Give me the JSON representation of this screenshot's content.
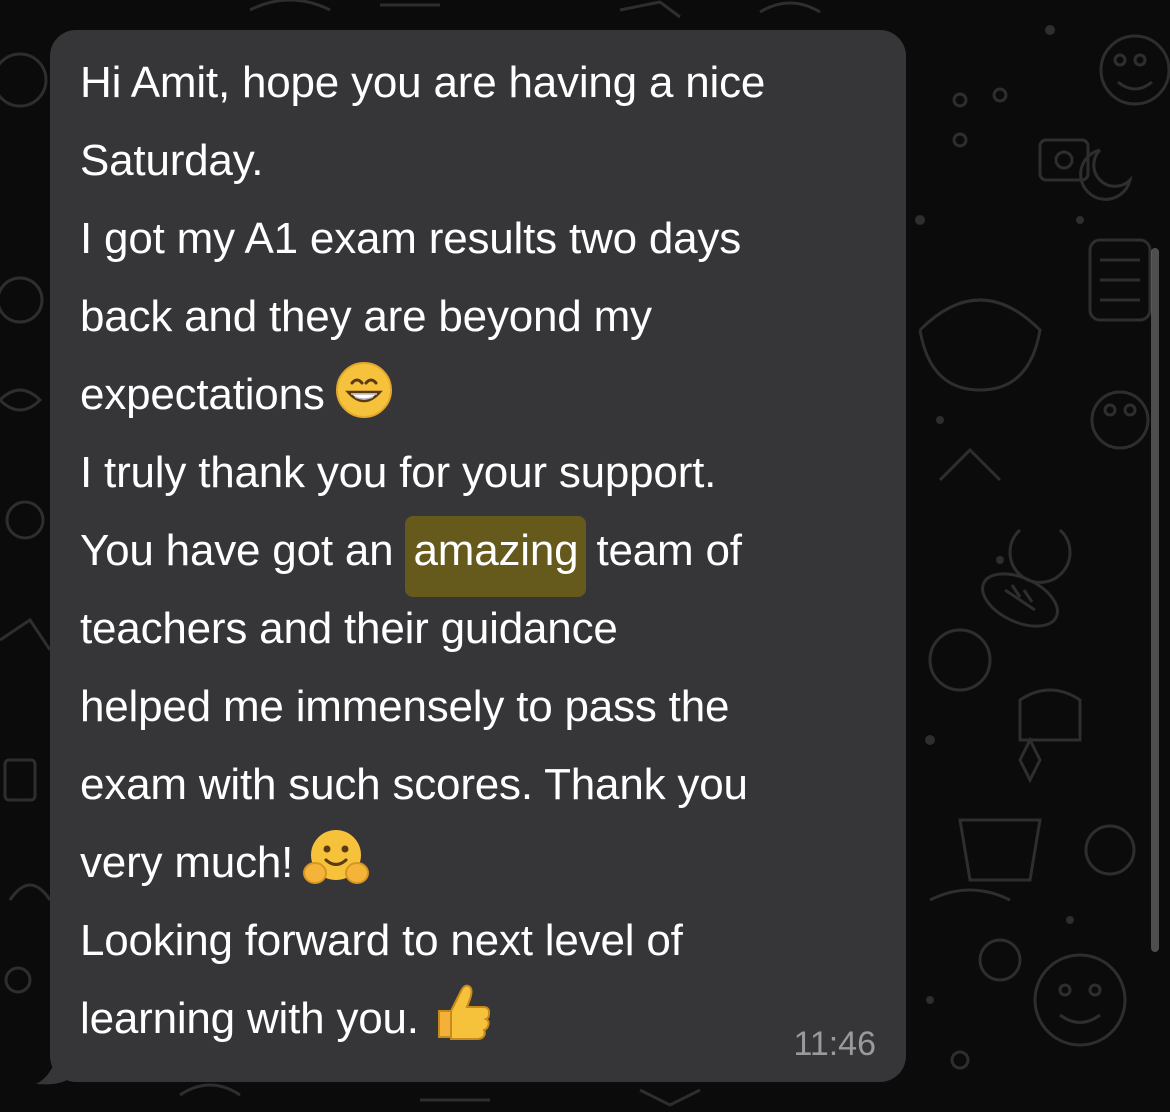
{
  "colors": {
    "background": "#0b0b0b",
    "bubble": "#363638",
    "text": "#ffffff",
    "highlight": "#66591c",
    "timestamp": "#9a9a9e"
  },
  "message": {
    "lines": [
      "Hi Amit, hope you are having a nice",
      "Saturday.",
      "I got my A1 exam results two days",
      "back and they are beyond my",
      "expectations",
      "I truly thank you for your support.",
      "You have got an",
      "amazing",
      "team of",
      "teachers and their guidance",
      "helped me immensely to pass the",
      "exam with such scores. Thank you",
      "very much!",
      "Looking forward to next level of",
      "learning with you."
    ],
    "emojis": [
      "grinning-face-emoji",
      "hugging-face-emoji",
      "thumbs-up-emoji"
    ],
    "timestamp": "11:46"
  }
}
